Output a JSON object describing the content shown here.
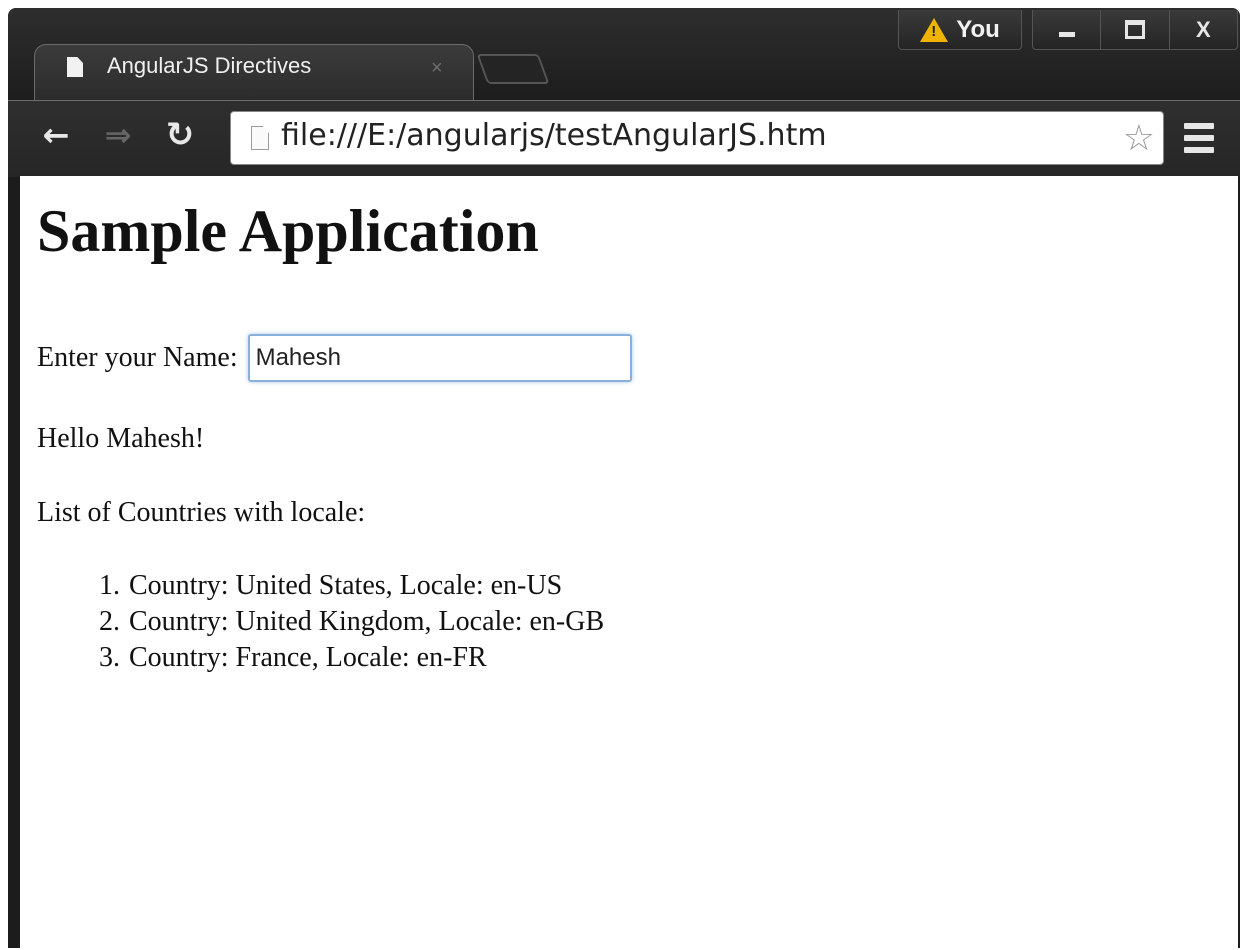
{
  "browser": {
    "tab_title": "AngularJS Directives",
    "tab_close": "×",
    "url": "file:///E:/angularjs/testAngularJS.htm",
    "profile_label": "You",
    "close_label": "X"
  },
  "page": {
    "heading": "Sample Application",
    "name_label": "Enter your Name:",
    "name_value": "Mahesh",
    "greeting": "Hello Mahesh!",
    "list_heading": "List of Countries with locale:",
    "countries": [
      "Country: United States, Locale: en-US",
      "Country: United Kingdom, Locale: en-GB",
      "Country: France, Locale: en-FR"
    ]
  },
  "colors": {
    "chrome_dark": "#1c1c1c",
    "warning": "#f0b400",
    "input_focus": "#8ab0d9"
  }
}
